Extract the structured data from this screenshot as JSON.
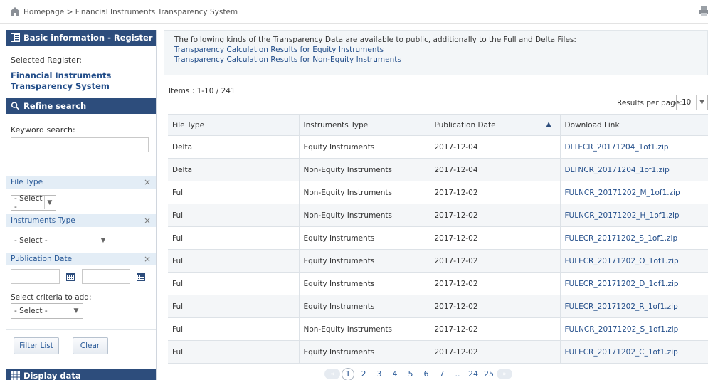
{
  "breadcrumb": "Homepage > Financial Instruments Transparency System",
  "icons": {
    "home": "house-icon",
    "print": "print-icon",
    "search": "magnifier-icon",
    "info": "list-icon",
    "display": "grid-icon",
    "calendar": "calendar-icon"
  },
  "colors": {
    "navy": "#2d4d7c",
    "link": "#234e8a",
    "filter_bar": "#e3edf6"
  },
  "sidebar": {
    "basic_header": "Basic information - Register",
    "selected_label": "Selected Register:",
    "selected_value": "Financial Instruments Transparency System",
    "refine_header": "Refine search",
    "keyword_label": "Keyword search:",
    "keyword_value": "",
    "filters": {
      "file_type": {
        "label": "File Type",
        "value": "- Select -"
      },
      "instruments_type": {
        "label": "Instruments Type",
        "value": "- Select -"
      },
      "publication_date": {
        "label": "Publication Date",
        "from": "",
        "to": ""
      }
    },
    "close_glyph": "×",
    "criteria_label": "Select criteria to add:",
    "criteria_value": "- Select -",
    "filter_button": "Filter List",
    "clear_button": "Clear",
    "display_header": "Display data"
  },
  "main": {
    "info_text": "The following kinds of the Transparency Data are available to public, additionally to the Full and Delta Files:",
    "links": [
      "Transparency Calculation Results for Equity Instruments",
      "Transparency Calculation Results for Non-Equity Instruments"
    ],
    "items_count": "Items : 1-10 / 241",
    "rpp_label": "Results per page:",
    "rpp_value": "10",
    "columns": [
      "File Type",
      "Instruments Type",
      "Publication Date",
      "Download Link"
    ],
    "rows": [
      [
        "Delta",
        "Equity Instruments",
        "2017-12-04",
        "DLTECR_20171204_1of1.zip"
      ],
      [
        "Delta",
        "Non-Equity Instruments",
        "2017-12-04",
        "DLTNCR_20171204_1of1.zip"
      ],
      [
        "Full",
        "Non-Equity Instruments",
        "2017-12-02",
        "FULNCR_20171202_M_1of1.zip"
      ],
      [
        "Full",
        "Non-Equity Instruments",
        "2017-12-02",
        "FULNCR_20171202_H_1of1.zip"
      ],
      [
        "Full",
        "Equity Instruments",
        "2017-12-02",
        "FULECR_20171202_S_1of1.zip"
      ],
      [
        "Full",
        "Equity Instruments",
        "2017-12-02",
        "FULECR_20171202_O_1of1.zip"
      ],
      [
        "Full",
        "Equity Instruments",
        "2017-12-02",
        "FULECR_20171202_D_1of1.zip"
      ],
      [
        "Full",
        "Equity Instruments",
        "2017-12-02",
        "FULECR_20171202_R_1of1.zip"
      ],
      [
        "Full",
        "Non-Equity Instruments",
        "2017-12-02",
        "FULNCR_20171202_S_1of1.zip"
      ],
      [
        "Full",
        "Equity Instruments",
        "2017-12-02",
        "FULECR_20171202_C_1of1.zip"
      ]
    ],
    "pagination": {
      "prev": "«",
      "next": "»",
      "pages": [
        "1",
        "2",
        "3",
        "4",
        "5",
        "6",
        "7",
        "..",
        "24",
        "25"
      ],
      "current": "1"
    }
  }
}
